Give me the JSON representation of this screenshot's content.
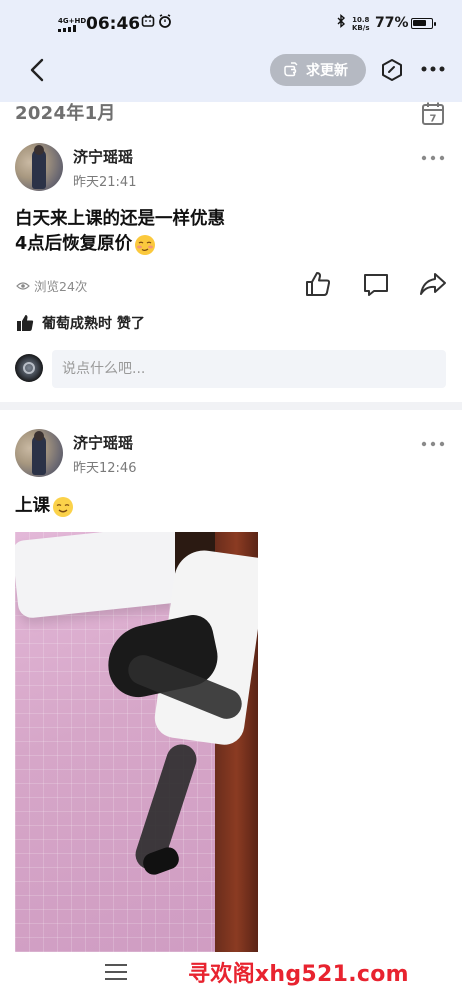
{
  "status_bar": {
    "network_label": "4G+HD",
    "time": "06:46",
    "speed_value": "10.8",
    "speed_unit": "KB/s",
    "battery_percent": "77%",
    "battery_level": 0.77
  },
  "nav": {
    "back_icon": "chevron-left-icon",
    "update_button_label": "求更新",
    "hex_icon": "hexagon-icon",
    "more_icon": "more-dots-icon"
  },
  "date_header": {
    "label": "2024年1月",
    "calendar_day": "7"
  },
  "posts": [
    {
      "username": "济宁瑶瑶",
      "time": "昨天21:41",
      "text_line1": "白天来上课的还是一样优惠",
      "text_line2": "4点后恢复原价",
      "views": "浏览24次",
      "likes_text": "葡萄成熟时 赞了",
      "comment_placeholder": "说点什么吧..."
    },
    {
      "username": "济宁瑶瑶",
      "time": "昨天12:46",
      "text_line1": "上课"
    }
  ],
  "bottom": {
    "menu_icon": "hamburger-icon",
    "watermark": "寻欢阁xhg521.com"
  },
  "colors": {
    "header_bg": "#e9eefa",
    "watermark_red": "#e8232f",
    "update_button_bg": "#b5b9c2"
  }
}
